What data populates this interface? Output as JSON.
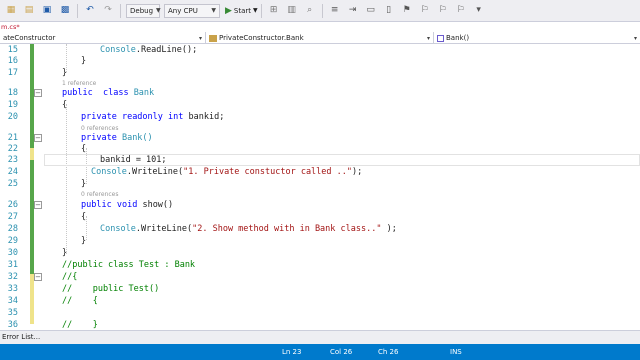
{
  "toolbar": {
    "config": "Debug",
    "platform": "Any CPU",
    "start_label": "Start"
  },
  "tab": {
    "file_name": "m.cs*"
  },
  "navbar": {
    "project": "ateConstructor",
    "type": "PrivateConstructor.Bank",
    "member": "Bank()"
  },
  "editor": {
    "lines": [
      {
        "num": "15",
        "text": "Console.ReadLine();"
      },
      {
        "num": "16",
        "text": "}"
      },
      {
        "num": "17",
        "text": "}"
      },
      {
        "num": "18",
        "lens": "1 reference"
      },
      {
        "num": "19",
        "text": "{"
      },
      {
        "num": "20",
        "text": "bankid;"
      },
      {
        "num": "21",
        "lens": "0 references"
      },
      {
        "num": "22",
        "text": "{"
      },
      {
        "num": "23",
        "text": "bankid = 101;"
      },
      {
        "num": "24",
        "text": "Console.WriteLine(\"1. Private constuctor called ..\");"
      },
      {
        "num": "25",
        "text": "}",
        "lens": "0 references"
      },
      {
        "num": "26",
        "text": "show()"
      },
      {
        "num": "27",
        "text": "{"
      },
      {
        "num": "28",
        "text": "Console.WriteLine(\"2. Show method with in Bank class..\" );"
      },
      {
        "num": "29",
        "text": "}"
      },
      {
        "num": "30",
        "text": "}"
      },
      {
        "num": "31",
        "text": "//public class Test : Bank"
      },
      {
        "num": "32",
        "text": "//{"
      },
      {
        "num": "33",
        "text": "//    public Test()"
      },
      {
        "num": "34",
        "text": "//    {"
      },
      {
        "num": "35",
        "text": ""
      },
      {
        "num": "36",
        "text": "//    }"
      }
    ],
    "tokens": {
      "public": "public",
      "class": "class",
      "bank": "Bank",
      "private": "private",
      "readonly": "readonly",
      "int": "int",
      "bank_ctor": "Bank()",
      "void": "void",
      "console": "Console",
      "readline_rest": ".ReadLine();",
      "writeline": ".WriteLine(",
      "str1": "\"1. Private constuctor called ..\"",
      "str2": "\"2. Show method with in Bank class..\"",
      "close1": ");",
      "close2": " );",
      "bankid_stmt": "bankid = 101;"
    }
  },
  "bottom": {
    "error_list": "Error List...",
    "ln": "Ln 23",
    "col": "Col 26",
    "ch": "Ch 26",
    "ins": "INS"
  },
  "colors": {
    "keyword": "#0000ff",
    "type": "#2b91af",
    "string": "#a31515",
    "comment": "#008000",
    "status_bar": "#007acc"
  }
}
